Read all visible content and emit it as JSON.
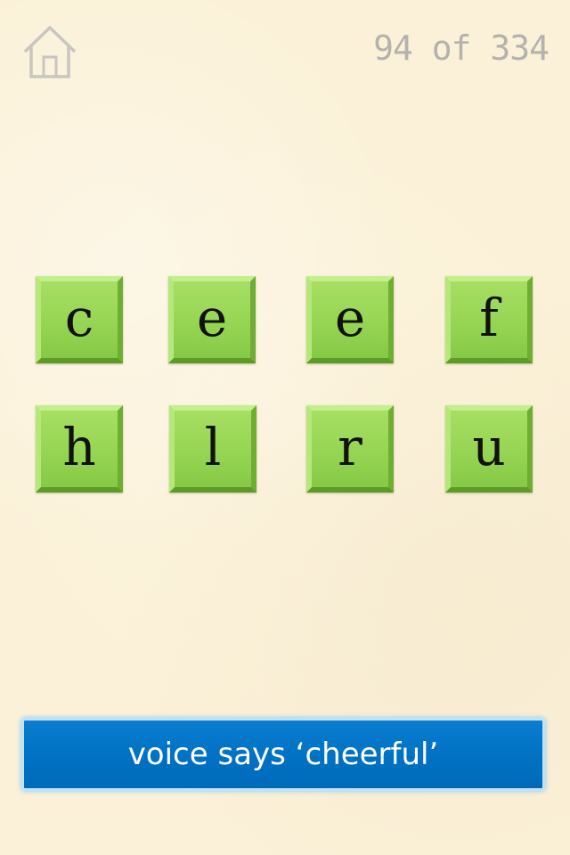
{
  "header": {
    "home_icon": "home-icon",
    "progress_text": "94 of 334"
  },
  "tiles": [
    {
      "letter": "c"
    },
    {
      "letter": "e"
    },
    {
      "letter": "e"
    },
    {
      "letter": "f"
    },
    {
      "letter": "h"
    },
    {
      "letter": "l"
    },
    {
      "letter": "r"
    },
    {
      "letter": "u"
    }
  ],
  "voice_button": {
    "label": "voice says ‘cheerful’"
  },
  "colors": {
    "background": "#fbf1d8",
    "tile_green": "#96d553",
    "button_blue": "#0172c4",
    "progress_gray": "#b4b2ad"
  }
}
